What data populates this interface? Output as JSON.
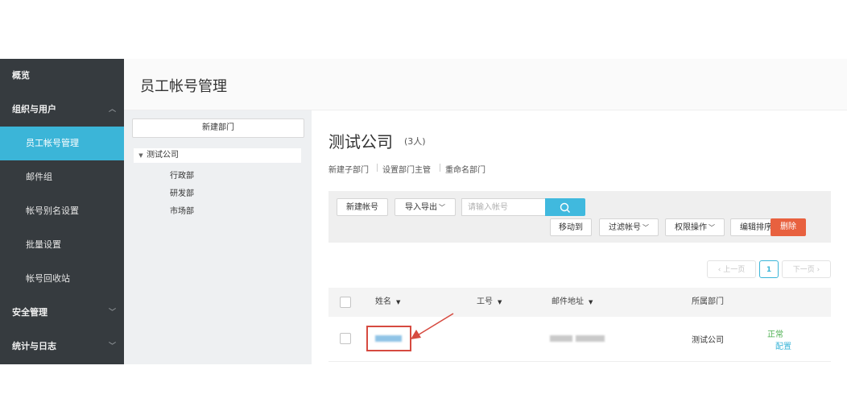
{
  "sidebar": {
    "items": [
      {
        "label": "概览"
      },
      {
        "label": "组织与用户"
      },
      {
        "label": "员工帐号管理"
      },
      {
        "label": "邮件组"
      },
      {
        "label": "帐号别名设置"
      },
      {
        "label": "批量设置"
      },
      {
        "label": "帐号回收站"
      },
      {
        "label": "安全管理"
      },
      {
        "label": "统计与日志"
      }
    ],
    "active_color": "#3bb5d8",
    "background": "#363b3f"
  },
  "header": {
    "title": "员工帐号管理"
  },
  "tree": {
    "new_dept_label": "新建部门",
    "root": "测试公司",
    "children": [
      "行政部",
      "研发部",
      "市场部"
    ]
  },
  "main": {
    "company": "测试公司",
    "member_count": "(3人)",
    "links": [
      "新建子部门",
      "设置部门主管",
      "重命名部门"
    ],
    "toolbar": {
      "new_account": "新建帐号",
      "import_export": "导入导出",
      "search_placeholder": "请输入帐号",
      "move_to": "移动到",
      "filter_accounts": "过滤帐号",
      "permission_ops": "权限操作",
      "edit_sort": "编辑排序",
      "delete": "删除"
    },
    "pagination": {
      "prev": "上一页",
      "current": "1",
      "next": "下一页"
    },
    "table": {
      "columns": [
        "姓名",
        "工号",
        "邮件地址",
        "所属部门"
      ],
      "rows": [
        {
          "department": "测试公司",
          "status": "正常",
          "action": "配置"
        }
      ]
    }
  },
  "icons": [
    "chevron-up-icon",
    "chevron-down-icon",
    "caret-down-icon",
    "search-icon",
    "sort-down-icon",
    "arrow-annotation-icon"
  ],
  "colors": {
    "accent": "#3bb5d8",
    "danger": "#e8613f",
    "status_ok": "#4caf50",
    "highlight": "#d64a40"
  }
}
